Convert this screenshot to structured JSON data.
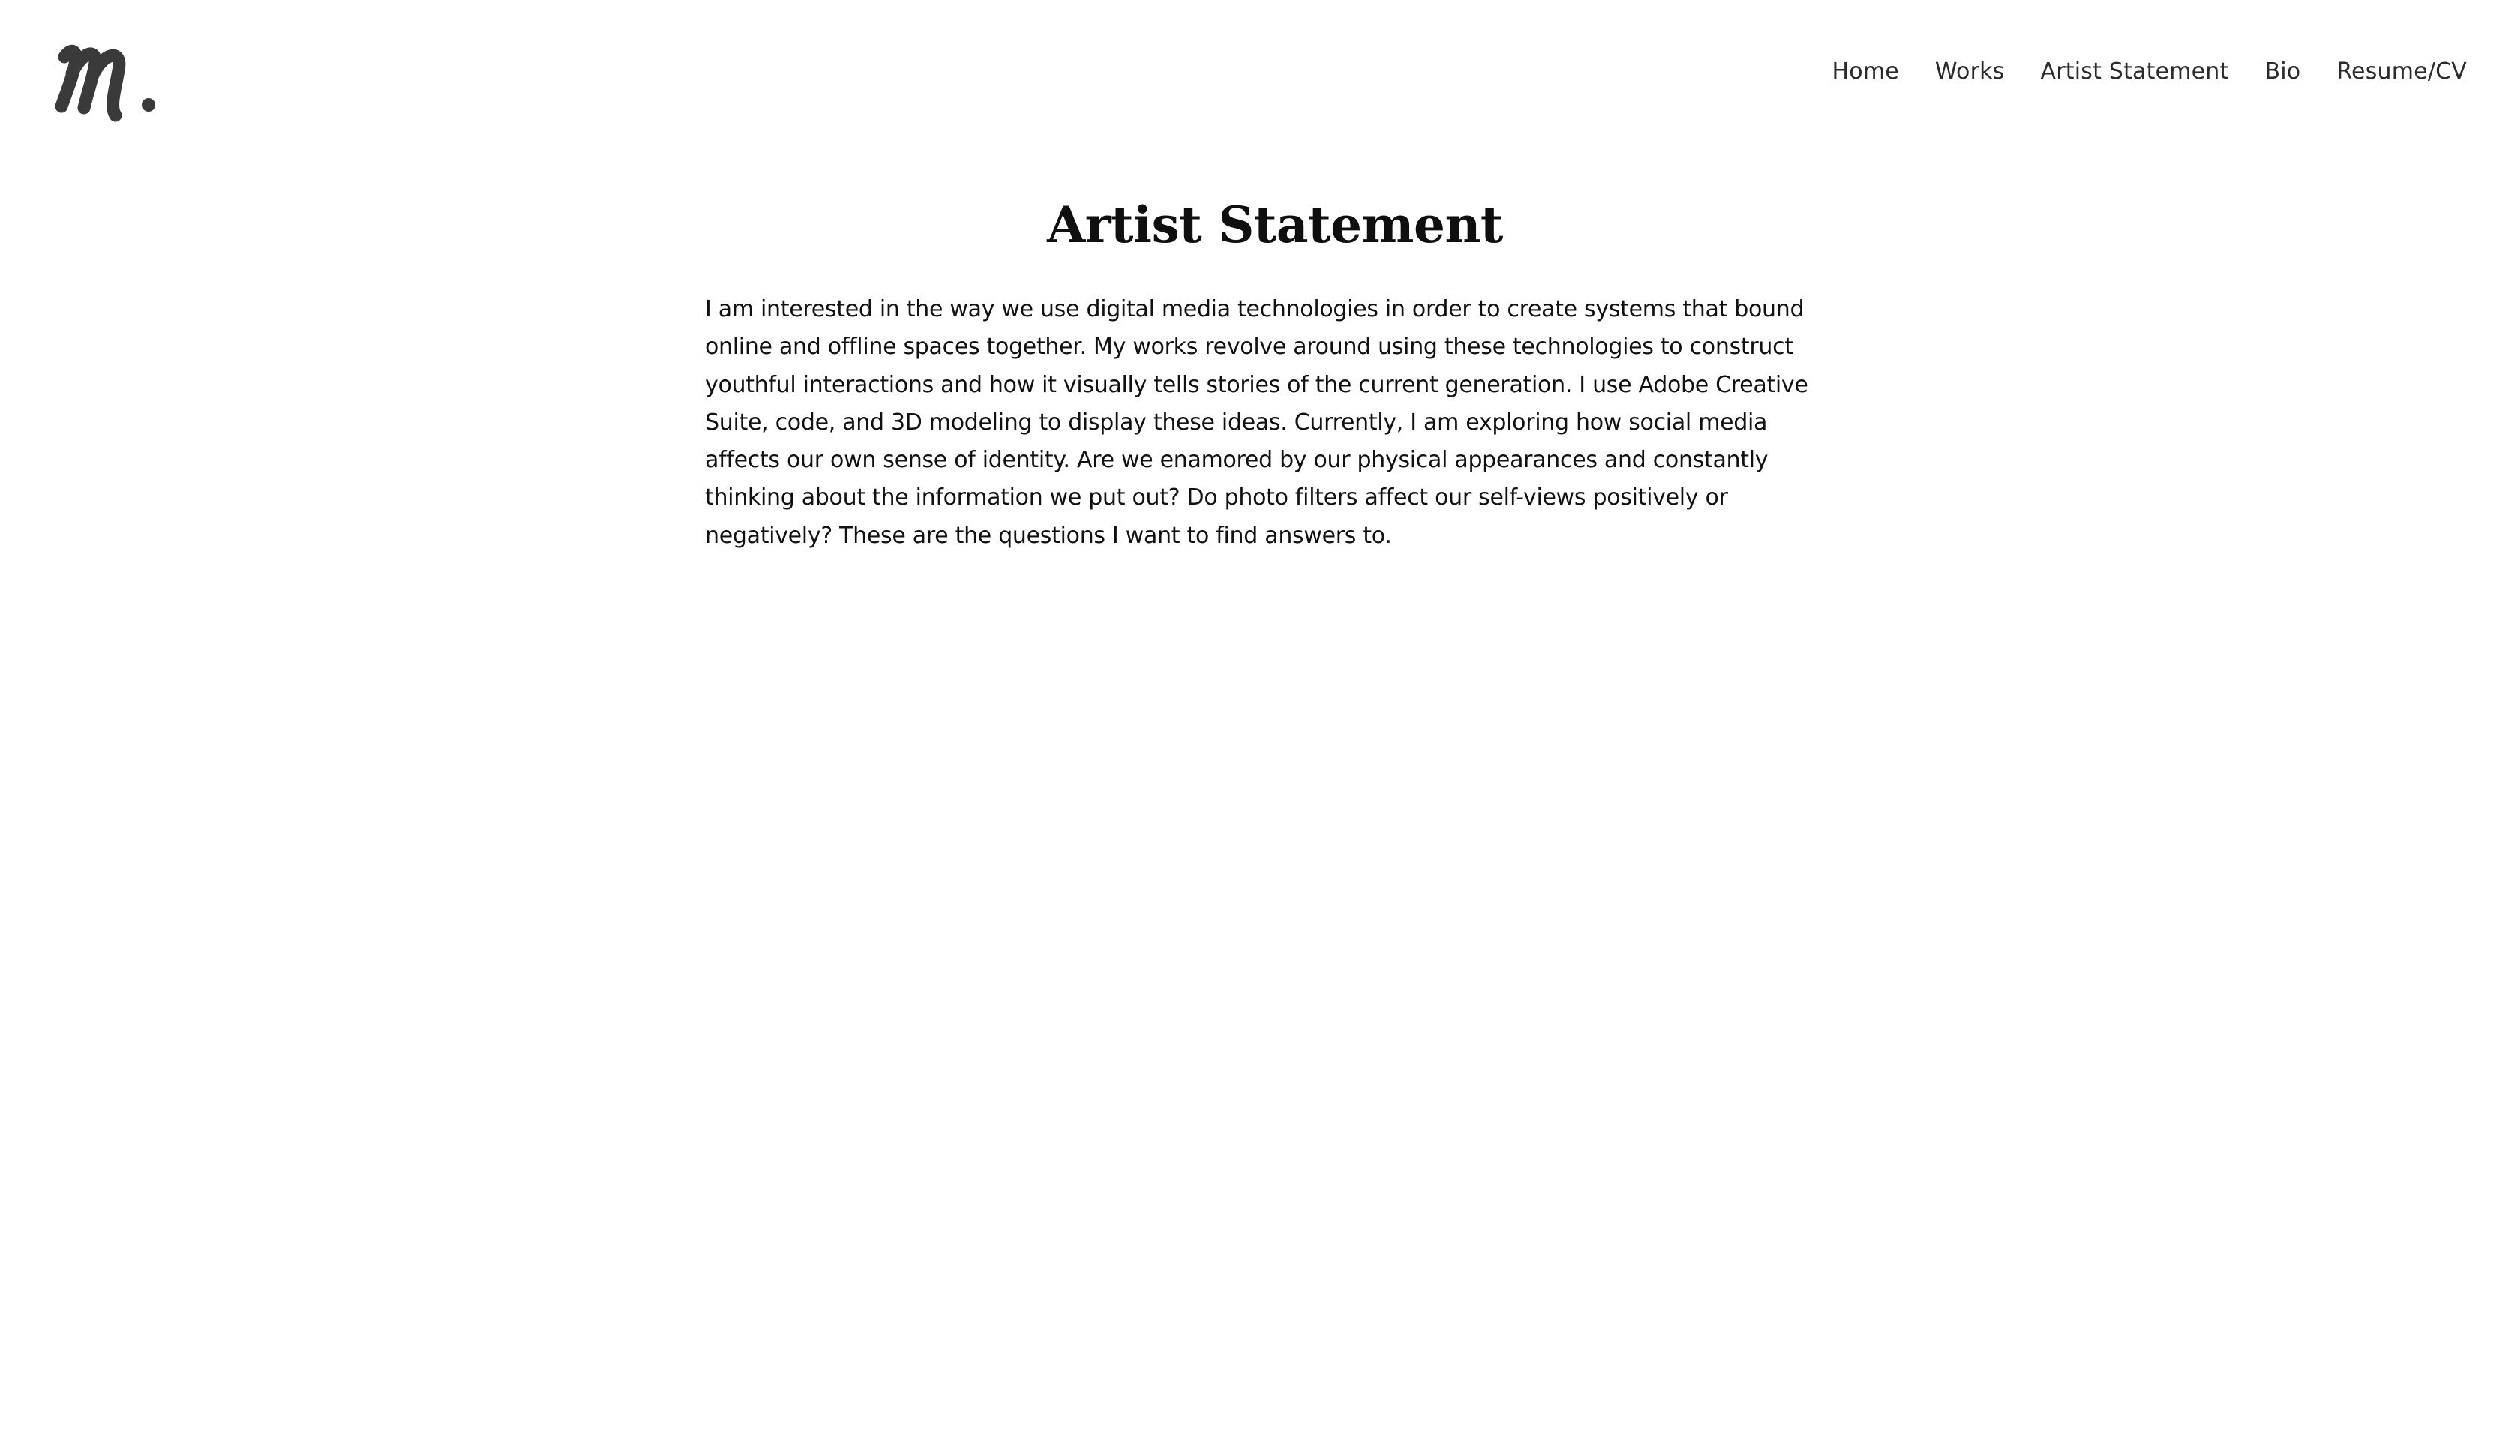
{
  "header": {
    "logo_icon": "script-m-logo-icon",
    "logo_text": "m."
  },
  "nav": {
    "items": [
      {
        "label": "Home"
      },
      {
        "label": "Works"
      },
      {
        "label": "Artist Statement"
      },
      {
        "label": "Bio"
      },
      {
        "label": "Resume/CV"
      }
    ]
  },
  "main": {
    "title": "Artist Statement",
    "statement": "I am interested in the way we use digital media technologies in order to create systems that bound online and offline spaces together. My works revolve around using these technologies to construct youthful interactions and how it visually tells stories of the current generation. I use Adobe Creative Suite, code, and 3D modeling to display these ideas. Currently, I am exploring how social media affects our own sense of identity. Are we enamored by our physical appearances and constantly thinking about the information we put out? Do photo filters affect our self-views positively or negatively? These are the questions I want to find answers to."
  },
  "colors": {
    "background": "#ffffff",
    "logo": "#3a3a3a",
    "text": "#111111"
  }
}
